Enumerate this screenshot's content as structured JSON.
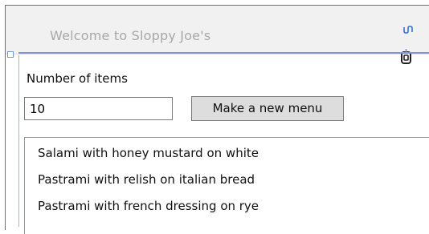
{
  "window": {
    "title": "Welcome to Sloppy Joe's"
  },
  "form": {
    "items_label": "Number of items",
    "items_value": "10",
    "make_menu_button": "Make a new menu"
  },
  "menu": {
    "items": [
      "Salami with honey mustard on white",
      "Pastrami with relish on italian bread",
      "Pastrami with french dressing on rye"
    ]
  },
  "icons": [
    "designer-glyph-icon",
    "designer-clip-icon",
    "selection-handle-icon"
  ]
}
